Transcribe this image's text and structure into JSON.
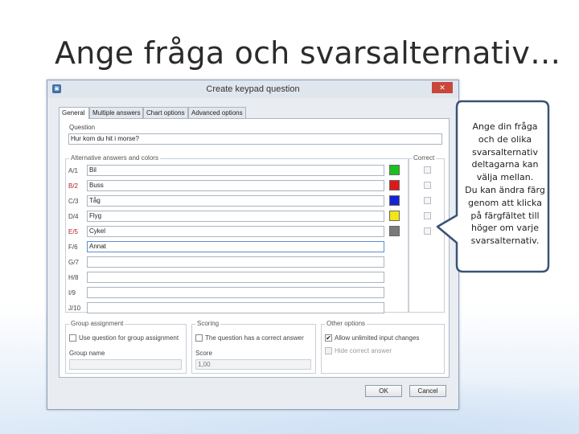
{
  "slide": {
    "title": "Ange fråga och svarsalternativ…"
  },
  "dialog": {
    "app_icon": "app-icon",
    "title": "Create keypad question",
    "close_label": "✕",
    "tabs": [
      "General",
      "Multiple answers",
      "Chart options",
      "Advanced options"
    ],
    "question_label": "Question",
    "question_value": "Hur kom du hit i morse?",
    "answers_group_title": "Alternative answers and colors",
    "correct_group_title": "Correct",
    "answers": [
      {
        "label": "A/1",
        "value": "Bil",
        "color": "#19c21e",
        "red_label": false
      },
      {
        "label": "B/2",
        "value": "Buss",
        "color": "#e01717",
        "red_label": true
      },
      {
        "label": "C/3",
        "value": "Tåg",
        "color": "#1424d6",
        "red_label": false
      },
      {
        "label": "D/4",
        "value": "Flyg",
        "color": "#f0e61a",
        "red_label": false
      },
      {
        "label": "E/5",
        "value": "Cykel",
        "color": "#7a7a7a",
        "red_label": true
      },
      {
        "label": "F/6",
        "value": "Annat",
        "color": null,
        "red_label": false
      },
      {
        "label": "G/7",
        "value": "",
        "color": null,
        "red_label": false
      },
      {
        "label": "H/8",
        "value": "",
        "color": null,
        "red_label": false
      },
      {
        "label": "I/9",
        "value": "",
        "color": null,
        "red_label": false
      },
      {
        "label": "J/10",
        "value": "",
        "color": null,
        "red_label": false
      }
    ],
    "group_assignment": {
      "title": "Group assignment",
      "checkbox_label": "Use question for group assignment",
      "group_name_label": "Group name",
      "group_name_value": ""
    },
    "scoring": {
      "title": "Scoring",
      "checkbox_label": "The question has a correct answer",
      "score_label": "Score",
      "score_value": "1,00"
    },
    "other_options": {
      "title": "Other options",
      "allow_label": "Allow unlimited input changes",
      "allow_checked": true,
      "hide_label": "Hide correct answer"
    },
    "ok_label": "OK",
    "cancel_label": "Cancel"
  },
  "callout": {
    "text": "Ange din fråga\noch de olika\nsvarsalternativ\ndeltagarna kan\nvälja mellan.\nDu kan ändra färg\ngenom att klicka\npå färgfältet till\nhöger om varje\nsvarsalternativ."
  }
}
